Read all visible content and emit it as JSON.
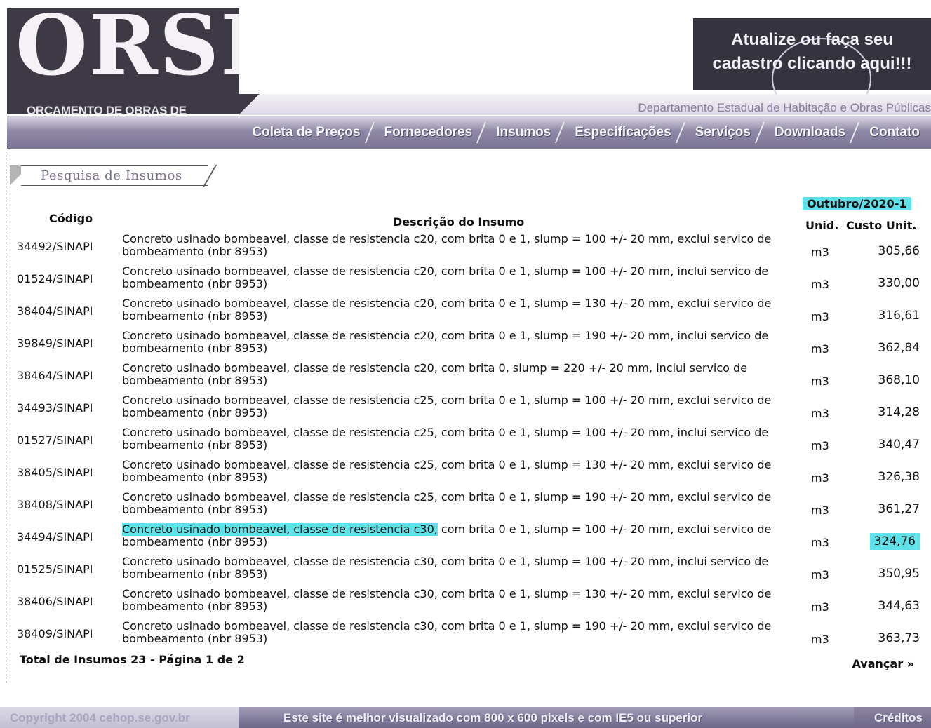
{
  "header": {
    "logo_text": "ORSE",
    "logo_subtitle": "ORÇAMENTO DE OBRAS DE SERGIPE",
    "promo_line1": "Atualize ou faça seu",
    "promo_line2": "cadastro clicando aqui!!!",
    "department": "Departamento Estadual de Habitação e Obras Públicas"
  },
  "nav": [
    "Coleta de Preços",
    "Fornecedores",
    "Insumos",
    "Especificações",
    "Serviços",
    "Downloads",
    "Contato"
  ],
  "section_title": "Pesquisa de Insumos",
  "period": "Outubro/2020-1",
  "table": {
    "headers": {
      "code": "Código",
      "description": "Descrição do Insumo",
      "unit": "Unid.",
      "cost": "Custo Unit."
    },
    "rows": [
      {
        "code": "34492/SINAPI",
        "description": "Concreto usinado bombeavel, classe de resistencia c20, com brita 0 e 1, slump = 100 +/- 20 mm, exclui servico de bombeamento (nbr 8953)",
        "unit": "m3",
        "cost": "305,66"
      },
      {
        "code": "01524/SINAPI",
        "description": "Concreto usinado bombeavel, classe de resistencia c20, com brita 0 e 1, slump = 100 +/- 20 mm, inclui servico de bombeamento (nbr 8953)",
        "unit": "m3",
        "cost": "330,00"
      },
      {
        "code": "38404/SINAPI",
        "description": "Concreto usinado bombeavel, classe de resistencia c20, com brita 0 e 1, slump = 130 +/- 20 mm, exclui servico de bombeamento (nbr 8953)",
        "unit": "m3",
        "cost": "316,61"
      },
      {
        "code": "39849/SINAPI",
        "description": "Concreto usinado bombeavel, classe de resistencia c20, com brita 0 e 1, slump = 190 +/- 20 mm, inclui servico de bombeamento (nbr 8953)",
        "unit": "m3",
        "cost": "362,84"
      },
      {
        "code": "38464/SINAPI",
        "description": "Concreto usinado bombeavel, classe de resistencia c20, com brita 0, slump = 220 +/- 20 mm, inclui servico de bombeamento (nbr 8953)",
        "unit": "m3",
        "cost": "368,10"
      },
      {
        "code": "34493/SINAPI",
        "description": "Concreto usinado bombeavel, classe de resistencia c25, com brita 0 e 1, slump = 100 +/- 20 mm, exclui servico de bombeamento (nbr 8953)",
        "unit": "m3",
        "cost": "314,28"
      },
      {
        "code": "01527/SINAPI",
        "description": "Concreto usinado bombeavel, classe de resistencia c25, com brita 0 e 1, slump = 100 +/- 20 mm, inclui servico de bombeamento (nbr 8953)",
        "unit": "m3",
        "cost": "340,47"
      },
      {
        "code": "38405/SINAPI",
        "description": "Concreto usinado bombeavel, classe de resistencia c25, com brita 0 e 1, slump = 130 +/- 20 mm, exclui servico de bombeamento (nbr 8953)",
        "unit": "m3",
        "cost": "326,38"
      },
      {
        "code": "38408/SINAPI",
        "description": "Concreto usinado bombeavel, classe de resistencia c25, com brita 0 e 1, slump = 190 +/- 20 mm, exclui servico de bombeamento (nbr 8953)",
        "unit": "m3",
        "cost": "361,27"
      },
      {
        "code": "34494/SINAPI",
        "description_highlight": "Concreto usinado bombeavel, classe de resistencia c30,",
        "description": " com brita 0 e 1, slump = 100 +/- 20 mm, exclui servico de bombeamento (nbr 8953)",
        "unit": "m3",
        "cost": "324,76"
      },
      {
        "code": "01525/SINAPI",
        "description": "Concreto usinado bombeavel, classe de resistencia c30, com brita 0 e 1, slump = 100 +/- 20 mm, inclui servico de bombeamento (nbr 8953)",
        "unit": "m3",
        "cost": "350,95"
      },
      {
        "code": "38406/SINAPI",
        "description": "Concreto usinado bombeavel, classe de resistencia c30, com brita 0 e 1, slump = 130 +/- 20 mm, exclui servico de bombeamento (nbr 8953)",
        "unit": "m3",
        "cost": "344,63"
      },
      {
        "code": "38409/SINAPI",
        "description": "Concreto usinado bombeavel, classe de resistencia c30, com brita 0 e 1, slump = 190 +/- 20 mm, exclui servico de bombeamento (nbr 8953)",
        "unit": "m3",
        "cost": "363,73"
      }
    ]
  },
  "pagination": {
    "summary": "Total de Insumos 23 - Página 1 de 2",
    "next": "Avançar »"
  },
  "footer": {
    "copyright": "Copyright 2004  cehop.se.gov.br",
    "note": "Este site é melhor visualizado com 800 x 600 pixels e com IE5 ou superior",
    "credits": "Créditos"
  },
  "colors": {
    "highlight": "#5fe1ea",
    "brand_dark": "#3d3a45",
    "nav_purple": "#7b7494"
  }
}
